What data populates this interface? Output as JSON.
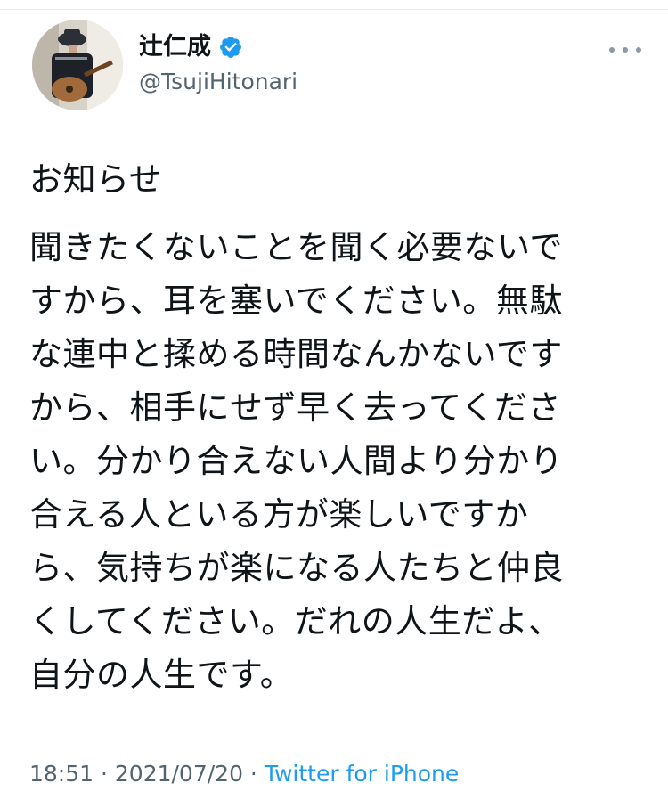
{
  "author": {
    "display_name": "辻仁成",
    "handle": "@TsujiHitonari",
    "verified": true,
    "avatar_icon": "guitarist-avatar"
  },
  "tweet": {
    "heading": "お知らせ",
    "body": "聞きたくないことを聞く必要ないで\nすから、耳を塞いでください。無駄\nな連中と揉める時間なんかないです\nから、相手にせず早く去ってくださ\nい。分かり合えない人間より分かり\n合える人といる方が楽しいですか\nら、気持ちが楽になる人たちと仲良\nくしてください。だれの人生だよ、\n自分の人生です。"
  },
  "meta": {
    "time": "18:51",
    "separator": " · ",
    "date": "2021/07/20",
    "source": "Twitter for iPhone"
  },
  "colors": {
    "accent": "#1d9bf0",
    "secondary_text": "#536471"
  }
}
